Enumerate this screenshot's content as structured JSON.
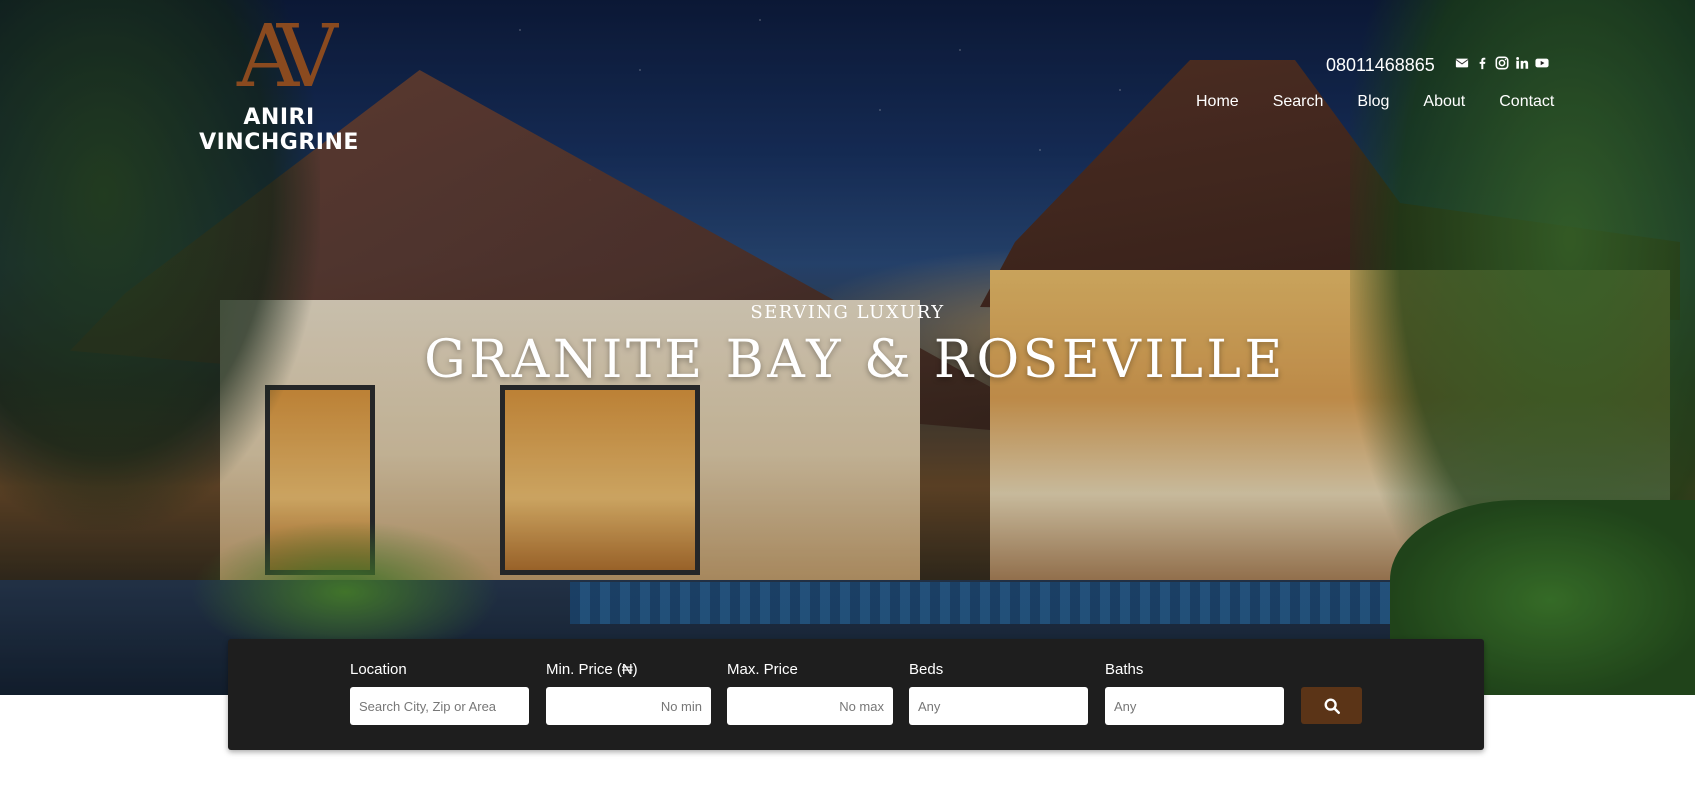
{
  "brand": {
    "logo_monogram": "AV",
    "name": "ANIRI VINCHGRINE",
    "logo_color": "#8a4a1f"
  },
  "header": {
    "phone": "08011468865",
    "social_icons": [
      "envelope-icon",
      "facebook-icon",
      "instagram-icon",
      "linkedin-icon",
      "youtube-icon"
    ]
  },
  "nav": {
    "items": [
      {
        "label": "Home"
      },
      {
        "label": "Search"
      },
      {
        "label": "Blog"
      },
      {
        "label": "About"
      },
      {
        "label": "Contact"
      }
    ]
  },
  "hero": {
    "tagline": "SERVING LUXURY",
    "headline": "GRANITE BAY & ROSEVILLE"
  },
  "search": {
    "background": "#1e1e1e",
    "button_color": "#5b3417",
    "button_icon": "search-icon",
    "fields": [
      {
        "label": "Location",
        "placeholder": "Search City, Zip or Area",
        "value": ""
      },
      {
        "label": "Min. Price (₦)",
        "placeholder": "No min",
        "value": ""
      },
      {
        "label": "Max. Price",
        "placeholder": "No max",
        "value": ""
      },
      {
        "label": "Beds",
        "placeholder": "Any",
        "value": ""
      },
      {
        "label": "Baths",
        "placeholder": "Any",
        "value": ""
      }
    ]
  }
}
